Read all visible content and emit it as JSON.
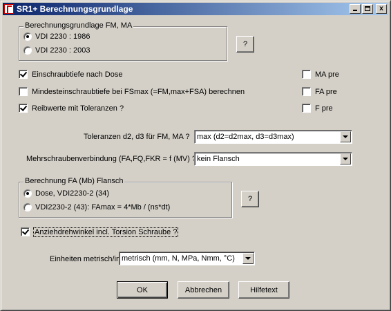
{
  "window": {
    "title": "SR1+  Berechnungsgrundlage",
    "minimize_label": "",
    "close_label": "x"
  },
  "group_fm_ma": {
    "legend": "Berechnungsgrundlage FM, MA",
    "options": [
      {
        "label": "VDI 2230 : 1986",
        "selected": true
      },
      {
        "label": "VDI 2230 : 2003",
        "selected": false
      }
    ],
    "help_label": "?"
  },
  "checks": {
    "einschraub": {
      "label": "Einschraubtiefe nach Dose",
      "checked": true
    },
    "mindest": {
      "label": "Mindesteinschraubtiefe bei FSmax (=FM,max+FSA) berechnen",
      "checked": false
    },
    "reibwerte": {
      "label": "Reibwerte mit Toleranzen ?",
      "checked": true
    },
    "ma_pre": {
      "label": "MA pre",
      "checked": false
    },
    "fa_pre": {
      "label": "FA pre",
      "checked": false
    },
    "f_pre": {
      "label": "F pre",
      "checked": false
    },
    "anzieh": {
      "label": "Anziehdrehwinkel incl. Torsion Schraube ?",
      "checked": true
    }
  },
  "toleranzen": {
    "label": "Toleranzen d2, d3 für FM, MA ?",
    "value": "max (d2=d2max, d3=d3max)"
  },
  "mehrschrauben": {
    "label": "Mehrschraubenverbindung (FA,FQ,FKR = f (MV) ?",
    "value": "kein Flansch"
  },
  "group_fa": {
    "legend": "Berechnung FA (Mb) Flansch",
    "options": [
      {
        "label": "Dose, VDI2230-2 (34)",
        "selected": true
      },
      {
        "label": "VDI2230-2 (43): FAmax = 4*Mb / (ns*dt)",
        "selected": false
      }
    ],
    "help_label": "?"
  },
  "einheiten": {
    "label": "Einheiten metrisch/imperial",
    "value": "metrisch (mm, N, MPa, Nmm, °C)"
  },
  "buttons": {
    "ok": "OK",
    "cancel": "Abbrechen",
    "help": "Hilfetext"
  }
}
